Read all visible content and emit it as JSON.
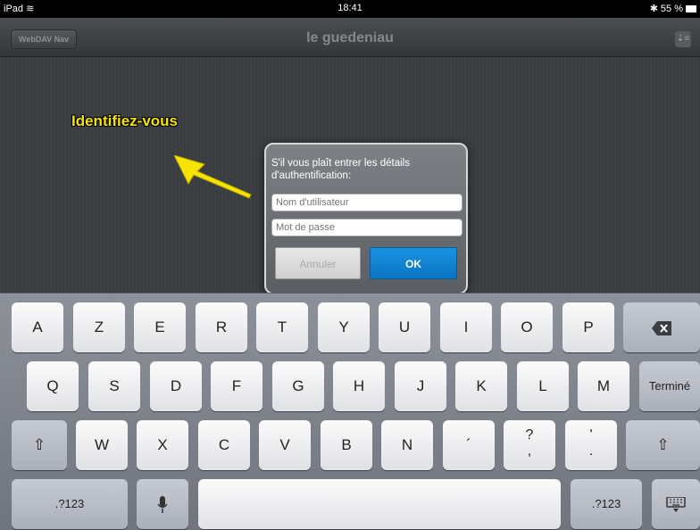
{
  "status_bar": {
    "device": "iPad",
    "time": "18:41",
    "battery": "55 %"
  },
  "nav": {
    "back_button": "WebDAV Nav",
    "title": "le guedeniau"
  },
  "annotation": {
    "text": "Identifiez-vous"
  },
  "dialog": {
    "message": "S'il vous plaît entrer les détails d'authentification:",
    "username_placeholder": "Nom d'utilisateur",
    "password_placeholder": "Mot de passe",
    "cancel_label": "Annuler",
    "ok_label": "OK"
  },
  "keyboard": {
    "row1": [
      "A",
      "Z",
      "E",
      "R",
      "T",
      "Y",
      "U",
      "I",
      "O",
      "P"
    ],
    "row2": [
      "Q",
      "S",
      "D",
      "F",
      "G",
      "H",
      "J",
      "K",
      "L",
      "M"
    ],
    "row3": [
      "W",
      "X",
      "C",
      "V",
      "B",
      "N"
    ],
    "done_label": "Terminé",
    "numbers_label": ".?123",
    "apostrophe_key": "´",
    "question_key": "?",
    "comma_key": ",",
    "quote_key": "'",
    "period_key": "."
  },
  "colors": {
    "ok_blue": "#0a7fd3",
    "annotation_yellow": "#f6e400"
  }
}
